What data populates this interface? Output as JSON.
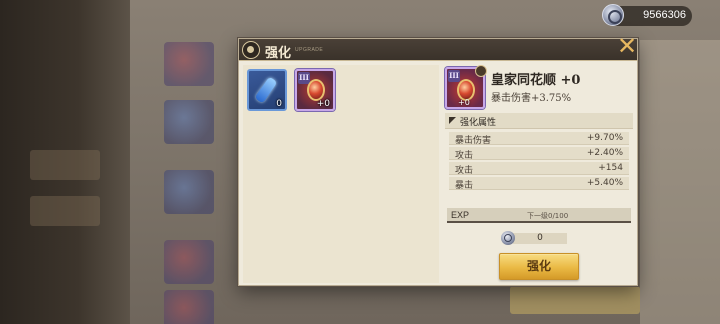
{
  "currency": {
    "icon": "crystal-coin-icon",
    "amount": "9566306"
  },
  "modal": {
    "title": "强化",
    "subtitle": "UPGRADE",
    "close_icon": "close-icon"
  },
  "inventory": [
    {
      "name": "blue-scroll-material",
      "icon": "scroll-icon",
      "count": "0"
    },
    {
      "name": "royal-flush-gem",
      "icon": "red-gem-icon",
      "tier": "III",
      "count": "+0"
    }
  ],
  "item": {
    "name": "皇家同花顺 +0",
    "stat": "暴击伤害+3.75%",
    "tier": "III",
    "level": "+0"
  },
  "attributes": {
    "header": "强化属性",
    "rows": [
      {
        "name": "暴击伤害",
        "value": "+9.70%"
      },
      {
        "name": "攻击",
        "value": "+2.40%"
      },
      {
        "name": "攻击",
        "value": "+154"
      },
      {
        "name": "暴击",
        "value": "+5.40%"
      }
    ]
  },
  "exp": {
    "label": "EXP",
    "progress": "下一级0/100",
    "fraction": 0
  },
  "cost": {
    "icon": "crystal-coin-icon",
    "amount": "0"
  },
  "enhance_button": "强化"
}
